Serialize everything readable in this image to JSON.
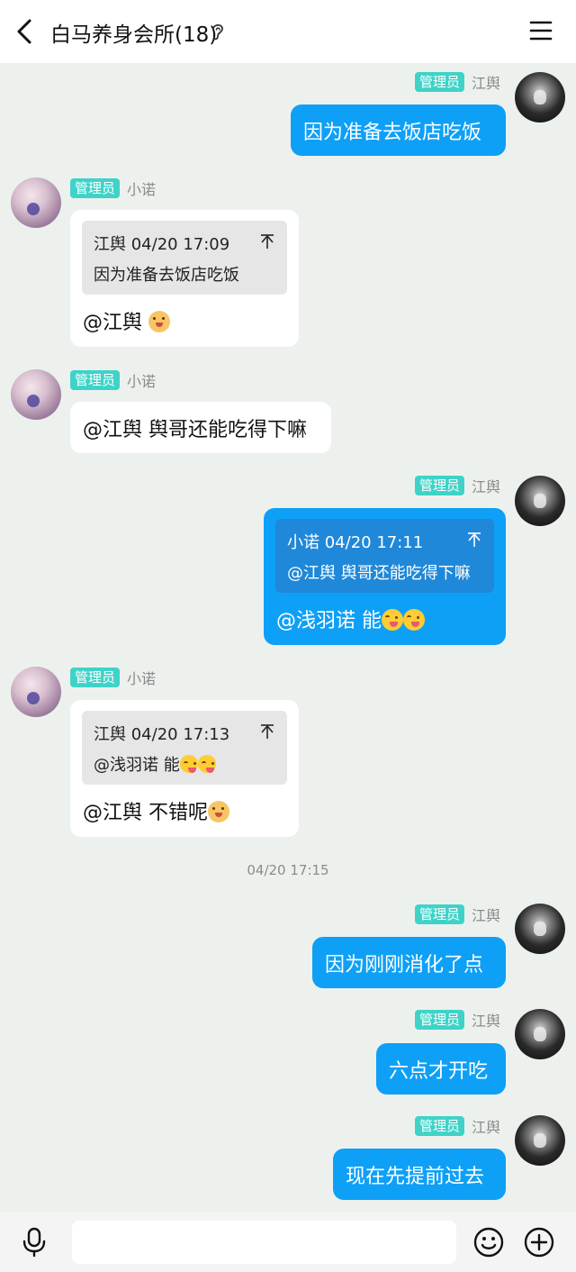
{
  "header": {
    "title": "白马养身会所(18)",
    "back_icon": "chevron-left-icon",
    "ear_icon": "ear-icon",
    "menu_icon": "hamburger-menu-icon"
  },
  "messages": [
    {
      "side": "out",
      "badge": "管理员",
      "sender": "江舆",
      "text": "因为准备去饭店吃饭"
    },
    {
      "side": "in",
      "badge": "管理员",
      "sender": "小诺",
      "quote": {
        "head": "江舆 04/20 17:09",
        "body": "因为准备去饭店吃饭"
      },
      "text": "@江舆 ",
      "emoji": "dog-face-emoji"
    },
    {
      "side": "in",
      "badge": "管理员",
      "sender": "小诺",
      "text": "@江舆 舆哥还能吃得下嘛"
    },
    {
      "side": "out",
      "badge": "管理员",
      "sender": "江舆",
      "quote": {
        "head": "小诺 04/20 17:11",
        "body": "@江舆 舆哥还能吃得下嘛"
      },
      "text": "@浅羽诺 能",
      "emoji": "yum-face-emoji"
    },
    {
      "side": "in",
      "badge": "管理员",
      "sender": "小诺",
      "quote": {
        "head": "江舆 04/20 17:13",
        "body": "@浅羽诺 能"
      },
      "text": "@江舆 不错呢",
      "emoji": "dog-face-emoji"
    },
    {
      "side": "out",
      "badge": "管理员",
      "sender": "江舆",
      "text": "因为刚刚消化了点"
    },
    {
      "side": "out",
      "badge": "管理员",
      "sender": "江舆",
      "text": "六点才开吃"
    },
    {
      "side": "out",
      "badge": "管理员",
      "sender": "江舆",
      "text": "现在先提前过去"
    }
  ],
  "timestamp": "04/20 17:15",
  "input": {
    "placeholder": "",
    "value": ""
  },
  "colors": {
    "background": "#edf1ee",
    "outgoing_bubble": "#0ea0f6",
    "incoming_bubble": "#ffffff",
    "admin_badge": "#3fd3c8"
  }
}
